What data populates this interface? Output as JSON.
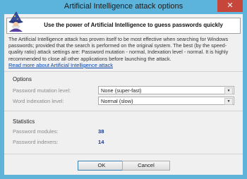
{
  "window": {
    "title": "Artificial Intelligence attack options",
    "close_glyph": "✕"
  },
  "banner": {
    "text": "Use the power of Artificial Intelligence to guess passwords quickly",
    "icon": "wizard-icon"
  },
  "description": "The Artificial Intelligence attack has proven itself to be most effective when searching for Windows passwords; provided that the search is performed on the original system. The best (by the speed-quality ratio) attack settings are: Password mutation - normal, Indexation level - normal. It is highly recommended to close all other applications before launching the attack.",
  "link": "Read more about Artificial Intelligence attack",
  "options": {
    "title": "Options",
    "mutation_label": "Password mutation level:",
    "mutation_value": "None (super-fast)",
    "indexation_label": "Word indexation level:",
    "indexation_value": "Normal (slow)"
  },
  "statistics": {
    "title": "Statistics",
    "modules_label": "Password modules:",
    "modules_value": "38",
    "indexers_label": "Password indexers:",
    "indexers_value": "14"
  },
  "buttons": {
    "ok": "OK",
    "cancel": "Cancel"
  }
}
